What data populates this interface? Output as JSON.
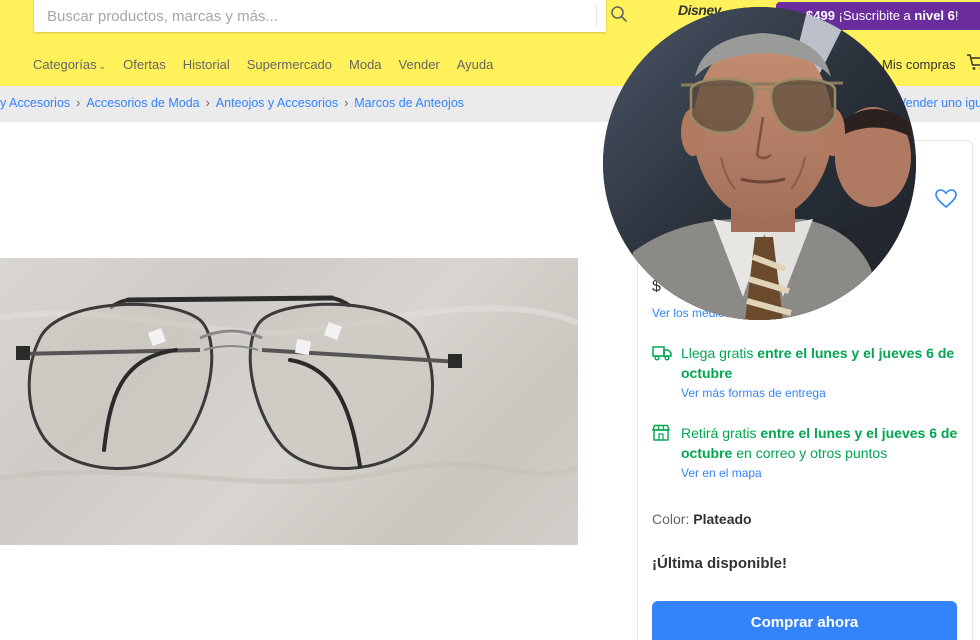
{
  "header": {
    "search_placeholder": "Buscar productos, marcas y más...",
    "brand_logo": "Disney",
    "promo": {
      "price": "$499",
      "text": " ¡Suscribite a ",
      "level": "nivel 6",
      "suffix": "!"
    },
    "nav": [
      {
        "label": "Categorías"
      },
      {
        "label": "Ofertas"
      },
      {
        "label": "Historial"
      },
      {
        "label": "Supermercado"
      },
      {
        "label": "Moda"
      },
      {
        "label": "Vender"
      },
      {
        "label": "Ayuda"
      }
    ],
    "my_purchases": "Mis compras"
  },
  "breadcrumb": {
    "items": [
      "y Accesorios",
      "Accesorios de Moda",
      "Anteojos y Accesorios",
      "Marcos de Anteojos"
    ],
    "sell_link": "Vender uno igual"
  },
  "panel": {
    "price_fragment": "$",
    "payment_link": "Ver los medios de pago",
    "shipping": {
      "prefix": "Llega gratis ",
      "bold": "entre el lunes y el jueves 6 de octubre",
      "link": "Ver más formas de entrega"
    },
    "pickup": {
      "prefix": "Retirá gratis ",
      "bold": "entre el lunes y el jueves 6 de octubre",
      "suffix": " en correo y otros puntos",
      "link": "Ver en el mapa"
    },
    "color_label": "Color: ",
    "color_value": "Plateado",
    "stock": "¡Última disponible!",
    "buy_button": "Comprar ahora"
  },
  "colors": {
    "header_yellow": "#fff159",
    "link_blue": "#3483fa",
    "free_green": "#00a650",
    "promo_purple": "#6b2d9e"
  }
}
